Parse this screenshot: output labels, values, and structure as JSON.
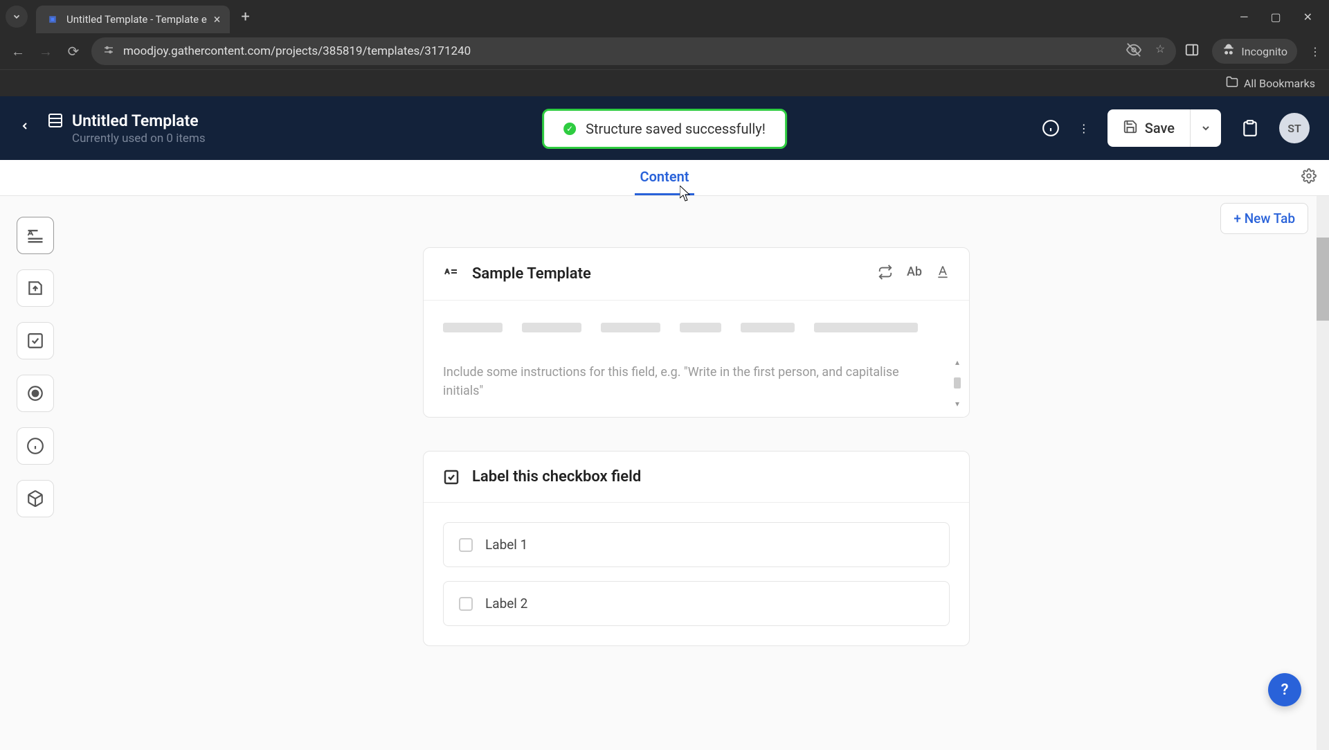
{
  "browser": {
    "tab_title": "Untitled Template - Template e",
    "url": "moodjoy.gathercontent.com/projects/385819/templates/3171240",
    "incognito_label": "Incognito",
    "bookmarks_label": "All Bookmarks"
  },
  "header": {
    "title": "Untitled Template",
    "subtitle": "Currently used on 0 items",
    "save_label": "Save",
    "avatar_initials": "ST"
  },
  "toast": {
    "message": "Structure saved successfully!"
  },
  "tabs": {
    "content_label": "Content",
    "new_tab_label": "+ New Tab"
  },
  "fields": {
    "text_field_title": "Sample Template",
    "instructions_placeholder": "Include some instructions for this field, e.g. \"Write in the first person, and capitalise initials\"",
    "ab_action": "Ab",
    "checkbox_field_title": "Label this checkbox field",
    "checkbox_options": [
      "Label 1",
      "Label 2"
    ]
  },
  "help_label": "?"
}
